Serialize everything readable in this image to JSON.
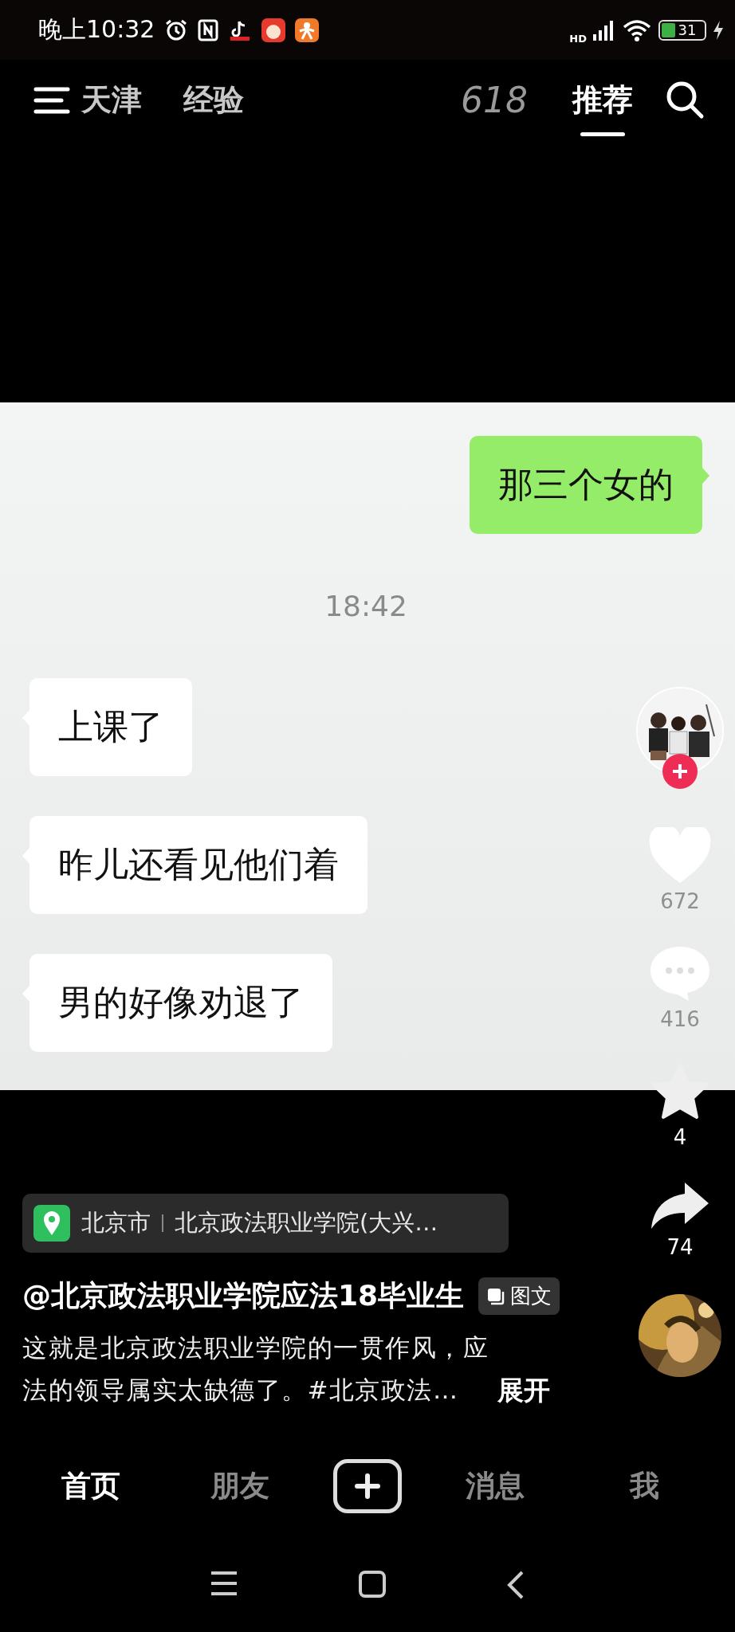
{
  "status_bar": {
    "time": "晚上10:32",
    "network": "HD",
    "battery": "31"
  },
  "top_tabs": [
    {
      "label": "天津",
      "kind": "text",
      "selected": false
    },
    {
      "label": "经验",
      "kind": "text",
      "selected": false
    },
    {
      "label": "618",
      "kind": "logo",
      "selected": false
    },
    {
      "label": "推荐",
      "kind": "text",
      "selected": true
    }
  ],
  "chat": {
    "messages": [
      {
        "kind": "outgoing",
        "text": "那三个女的"
      },
      {
        "kind": "time",
        "text": "18:42"
      },
      {
        "kind": "incoming",
        "text": "上课了"
      },
      {
        "kind": "incoming",
        "text": "昨儿还看见他们着"
      },
      {
        "kind": "incoming",
        "text": "男的好像劝退了"
      }
    ]
  },
  "actions": {
    "likes": "672",
    "comments": "416",
    "favorites": "4",
    "shares": "74"
  },
  "location": {
    "city": "北京市",
    "place": "北京政法职业学院(大兴…"
  },
  "author": "@北京政法职业学院应法18毕业生",
  "post_type": "图文",
  "description": "这就是北京政法职业学院的一贯作风，应法的领导属实太缺德了。#北京政法…",
  "expand": "展开",
  "bottom_nav": [
    {
      "kind": "text",
      "label": "首页",
      "selected": true
    },
    {
      "kind": "text",
      "label": "朋友",
      "selected": false
    },
    {
      "kind": "add",
      "selected": false
    },
    {
      "kind": "text",
      "label": "消息",
      "selected": false
    },
    {
      "kind": "text",
      "label": "我",
      "selected": false
    }
  ]
}
